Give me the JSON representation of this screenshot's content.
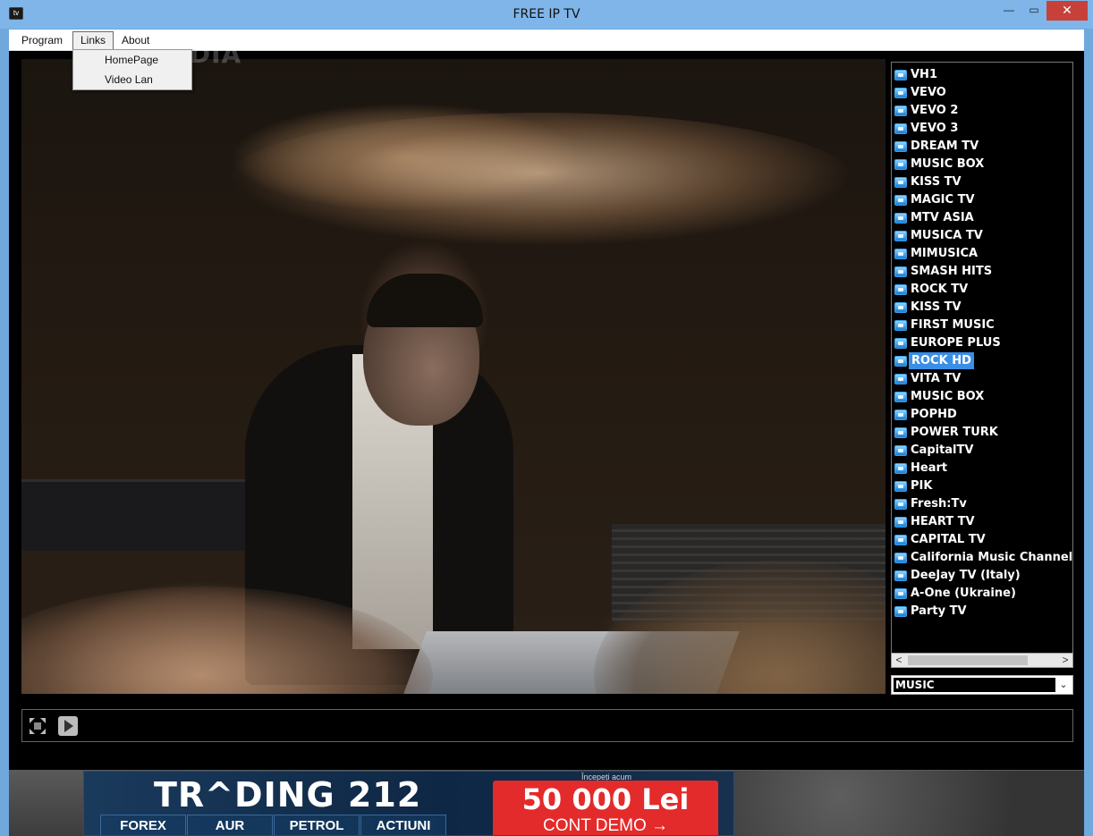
{
  "window": {
    "title": "FREE IP TV",
    "icon_label": "tv",
    "min_glyph": "—",
    "max_glyph": "▭",
    "close_glyph": "✕"
  },
  "menu": {
    "items": [
      {
        "label": "Program"
      },
      {
        "label": "Links"
      },
      {
        "label": "About"
      }
    ],
    "links_dropdown": [
      {
        "label": "HomePage"
      },
      {
        "label": "Video Lan"
      }
    ]
  },
  "watermark": "SOFTPEDIA",
  "channels": [
    {
      "label": "VH1"
    },
    {
      "label": "VEVO"
    },
    {
      "label": "VEVO 2"
    },
    {
      "label": "VEVO 3"
    },
    {
      "label": "DREAM TV"
    },
    {
      "label": "MUSIC BOX"
    },
    {
      "label": "KISS TV"
    },
    {
      "label": "MAGIC TV"
    },
    {
      "label": "MTV ASIA"
    },
    {
      "label": "MUSICA TV"
    },
    {
      "label": "MIMUSICA"
    },
    {
      "label": "SMASH HITS"
    },
    {
      "label": "ROCK TV"
    },
    {
      "label": "KISS TV"
    },
    {
      "label": "FIRST MUSIC"
    },
    {
      "label": "EUROPE PLUS"
    },
    {
      "label": "ROCK HD",
      "selected": true
    },
    {
      "label": "VITA TV"
    },
    {
      "label": "MUSIC BOX"
    },
    {
      "label": "POPHD"
    },
    {
      "label": "POWER TURK"
    },
    {
      "label": "CapitalTV"
    },
    {
      "label": "Heart"
    },
    {
      "label": "PIK"
    },
    {
      "label": "Fresh:Tv"
    },
    {
      "label": "HEART TV"
    },
    {
      "label": "CAPITAL TV"
    },
    {
      "label": "California Music Channel ("
    },
    {
      "label": "DeeJay TV (Italy)"
    },
    {
      "label": "A-One (Ukraine)"
    },
    {
      "label": "Party TV"
    }
  ],
  "scrollbar": {
    "left_glyph": "<",
    "right_glyph": ">"
  },
  "category": {
    "value": "MUSIC",
    "arrow_glyph": "⌄"
  },
  "controls": {
    "fullscreen_icon": "fullscreen-icon",
    "play_icon": "play-icon"
  },
  "ad": {
    "brand": "TR^DING 212",
    "tabs": [
      "FOREX",
      "AUR",
      "PETROL",
      "ACTIUNI"
    ],
    "cta_small": "Începeți acum",
    "cta_amount": "50 000 Lei",
    "cta_sub": "CONT DEMO →"
  },
  "colors": {
    "titlebar": "#7fb5e8",
    "close_button": "#c7413a",
    "selected_channel": "#3a8ee6",
    "ad_cta": "#e32b2b"
  }
}
